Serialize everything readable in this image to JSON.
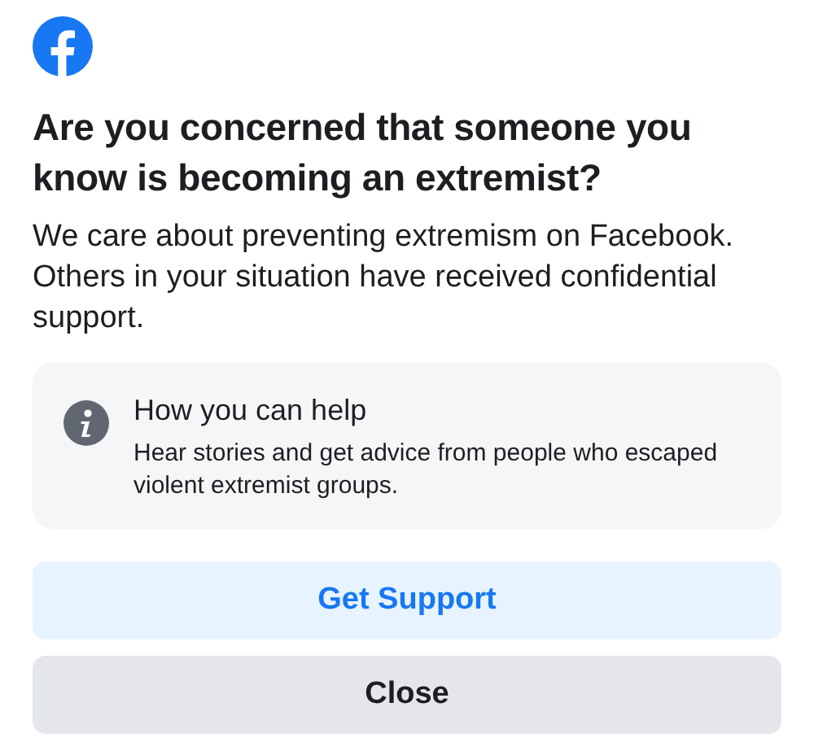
{
  "title": "Are you concerned that someone you know is becoming an extremist?",
  "body": "We care about preventing extremism on Facebook. Others in your situation have received confidential support.",
  "info_card": {
    "heading": "How you can help",
    "text": "Hear stories and get advice from people who escaped violent extremist groups."
  },
  "buttons": [
    {
      "label": "Get Support",
      "kind": "primary"
    },
    {
      "label": "Close",
      "kind": "secondary"
    }
  ]
}
